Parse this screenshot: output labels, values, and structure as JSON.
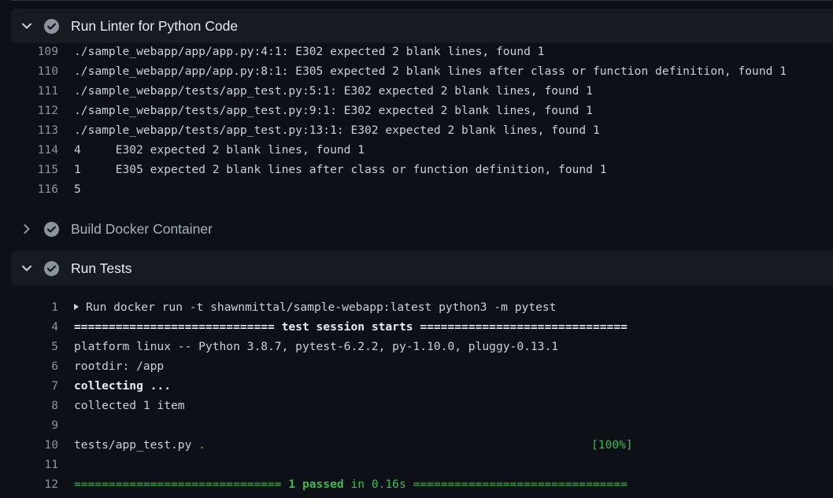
{
  "steps": [
    {
      "title": "Run Linter for Python Code",
      "state": "expanded"
    },
    {
      "title": "Build Docker Container",
      "state": "collapsed"
    },
    {
      "title": "Run Tests",
      "state": "expanded"
    }
  ],
  "linter_log": [
    {
      "num": "109",
      "text": "./sample_webapp/app/app.py:4:1: E302 expected 2 blank lines, found 1"
    },
    {
      "num": "110",
      "text": "./sample_webapp/app/app.py:8:1: E305 expected 2 blank lines after class or function definition, found 1"
    },
    {
      "num": "111",
      "text": "./sample_webapp/tests/app_test.py:5:1: E302 expected 2 blank lines, found 1"
    },
    {
      "num": "112",
      "text": "./sample_webapp/tests/app_test.py:9:1: E302 expected 2 blank lines, found 1"
    },
    {
      "num": "113",
      "text": "./sample_webapp/tests/app_test.py:13:1: E302 expected 2 blank lines, found 1"
    },
    {
      "num": "114",
      "text": "4     E302 expected 2 blank lines, found 1"
    },
    {
      "num": "115",
      "text": "1     E305 expected 2 blank lines after class or function definition, found 1"
    },
    {
      "num": "116",
      "text": "5"
    }
  ],
  "tests_log": {
    "line1": {
      "num": "1",
      "text": "Run docker run -t shawnmittal/sample-webapp:latest python3 -m pytest"
    },
    "line4": {
      "num": "4",
      "pre": "============================= ",
      "mid": "test session starts",
      "post": " =============================="
    },
    "line5": {
      "num": "5",
      "text": "platform linux -- Python 3.8.7, pytest-6.2.2, py-1.10.0, pluggy-0.13.1"
    },
    "line6": {
      "num": "6",
      "text": "rootdir: /app"
    },
    "line7": {
      "num": "7",
      "text": "collecting ..."
    },
    "line8": {
      "num": "8",
      "text": "collected 1 item"
    },
    "line9": {
      "num": "9",
      "text": ""
    },
    "line10": {
      "num": "10",
      "text": "tests/app_test.py",
      "dot": " .",
      "pct": "[100%]"
    },
    "line11": {
      "num": "11",
      "text": ""
    },
    "line12": {
      "num": "12",
      "pre": "============================== ",
      "passed": "1 passed",
      "mid": " in 0.16s ",
      "post": "==============================="
    }
  },
  "colors": {
    "background": "#0d1117",
    "header_bg": "#161b22",
    "success": "#3fb950",
    "status_icon": "#8b949e"
  },
  "icons": {
    "expanded": "chevron-down-icon",
    "collapsed": "chevron-right-icon",
    "status": "check-circle-icon"
  }
}
